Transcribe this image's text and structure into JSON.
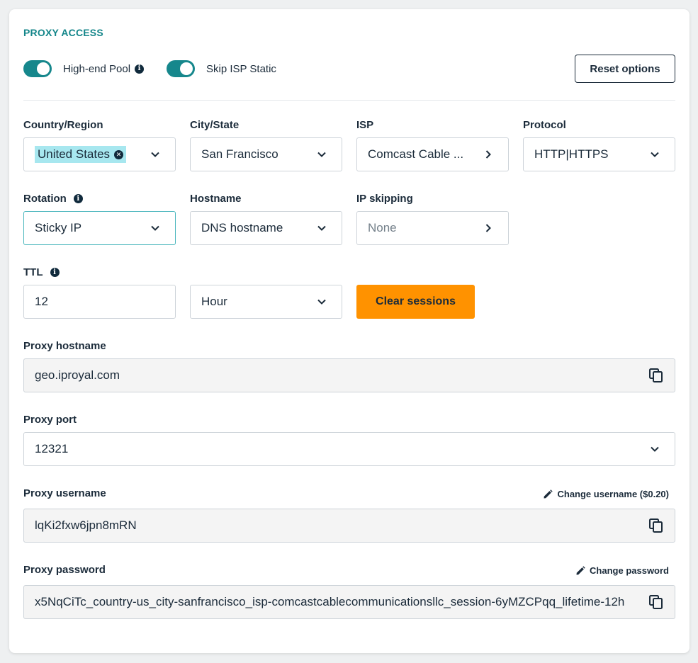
{
  "section_title": "PROXY ACCESS",
  "toggles": [
    {
      "label": "High-end Pool",
      "on": true,
      "has_info": true
    },
    {
      "label": "Skip ISP Static",
      "on": true,
      "has_info": false
    }
  ],
  "reset_button": "Reset options",
  "accent_color": "#16878c",
  "fields": {
    "country": {
      "label": "Country/Region",
      "chip": "United States"
    },
    "city": {
      "label": "City/State",
      "value": "San Francisco"
    },
    "isp": {
      "label": "ISP",
      "value": "Comcast Cable ..."
    },
    "protocol": {
      "label": "Protocol",
      "value": "HTTP|HTTPS"
    },
    "rotation": {
      "label": "Rotation",
      "value": "Sticky IP"
    },
    "hostname": {
      "label": "Hostname",
      "value": "DNS hostname"
    },
    "ip_skipping": {
      "label": "IP skipping",
      "placeholder": "None"
    },
    "ttl": {
      "label": "TTL",
      "value": "12",
      "unit": "Hour"
    }
  },
  "clear_sessions_button": "Clear sessions",
  "proxy_hostname": {
    "label": "Proxy hostname",
    "value": "geo.iproyal.com"
  },
  "proxy_port": {
    "label": "Proxy port",
    "value": "12321"
  },
  "proxy_username": {
    "label": "Proxy username",
    "value": "lqKi2fxw6jpn8mRN",
    "action": "Change username ($0.20)"
  },
  "proxy_password": {
    "label": "Proxy password",
    "value": "x5NqCiTc_country-us_city-sanfrancisco_isp-comcastcablecommunicationsllc_session-6yMZCPqq_lifetime-12h",
    "action": "Change password"
  }
}
